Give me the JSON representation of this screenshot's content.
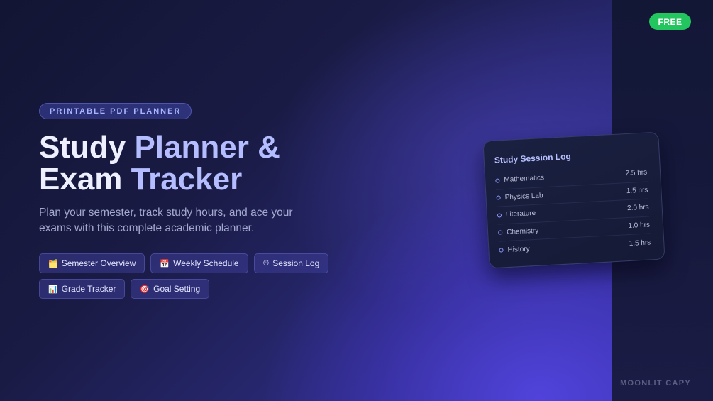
{
  "badge": {
    "label": "FREE",
    "color": "#22c55e"
  },
  "brand": {
    "label": "MOONLIT CAPY"
  },
  "hero": {
    "tag": "PRINTABLE PDF PLANNER",
    "title_line1_a": "Study ",
    "title_line1_b": "Planner &",
    "title_line2_a": "Exam ",
    "title_line2_b": "Tracker",
    "subtitle": "Plan your semester, track study hours, and ace your exams with this complete academic planner."
  },
  "features": [
    {
      "icon": "🗂️",
      "icon_name": "folders-icon",
      "label": "Semester Overview"
    },
    {
      "icon": "📅",
      "icon_name": "calendar-icon",
      "label": "Weekly Schedule"
    },
    {
      "icon": "⏱",
      "icon_name": "stopwatch-icon",
      "label": "Session Log"
    },
    {
      "icon": "📊",
      "icon_name": "bar-chart-icon",
      "label": "Grade Tracker"
    },
    {
      "icon": "🎯",
      "icon_name": "target-icon",
      "label": "Goal Setting"
    }
  ],
  "session_card": {
    "title": "Study Session Log",
    "rows": [
      {
        "subject": "Mathematics",
        "hours": "2.5 hrs"
      },
      {
        "subject": "Physics Lab",
        "hours": "1.5 hrs"
      },
      {
        "subject": "Literature",
        "hours": "2.0 hrs"
      },
      {
        "subject": "Chemistry",
        "hours": "1.0 hrs"
      },
      {
        "subject": "History",
        "hours": "1.5 hrs"
      }
    ]
  },
  "colors": {
    "accent": "#b4bdff",
    "title_text": "#eef0ff",
    "background_dark": "#151836",
    "background_glow": "#4a3fd0"
  }
}
